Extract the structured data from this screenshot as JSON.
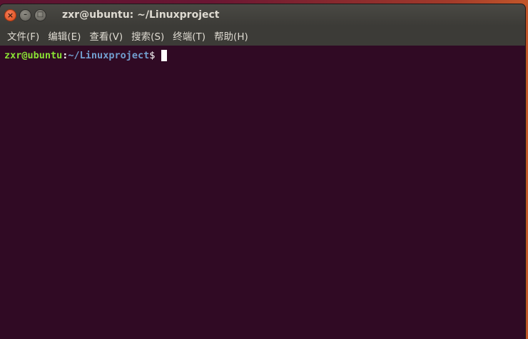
{
  "window": {
    "title": "zxr@ubuntu: ~/Linuxproject",
    "close_glyph": "×",
    "minimize_glyph": "–",
    "maximize_glyph": "□"
  },
  "menubar": {
    "items": [
      "文件(F)",
      "编辑(E)",
      "查看(V)",
      "搜索(S)",
      "终端(T)",
      "帮助(H)"
    ]
  },
  "terminal": {
    "user_host": "zxr@ubuntu",
    "separator": ":",
    "path": "~/Linuxproject",
    "prompt_symbol": "$",
    "colors": {
      "background": "#300a24",
      "user": "#8ae234",
      "path": "#729fcf"
    }
  }
}
